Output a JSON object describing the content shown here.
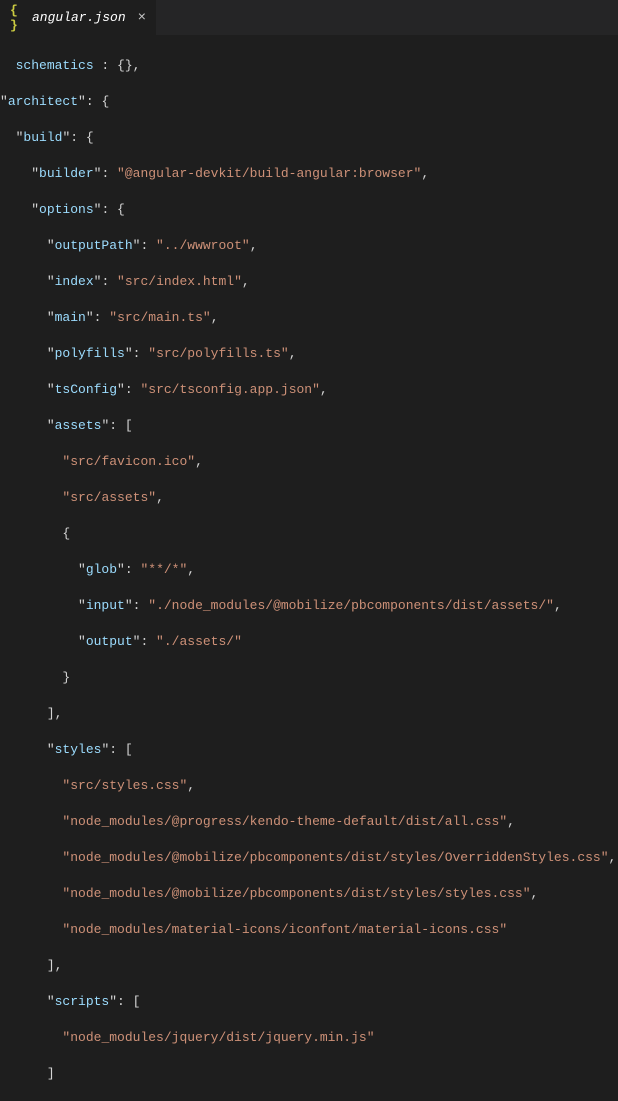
{
  "tab": {
    "filename": "angular.json",
    "icon_text": "{ }"
  },
  "code": {
    "l1_k": "schematics",
    "l1_tail": " : {},",
    "l2_k": "architect",
    "l2_tail": ": {",
    "l3_k": "build",
    "l3_tail": ": {",
    "l4_k": "builder",
    "l4_v": "@angular-devkit/build-angular:browser",
    "l5_k": "options",
    "l5_tail": ": {",
    "l6_k": "outputPath",
    "l6_v": "../wwwroot",
    "l7_k": "index",
    "l7_v": "src/index.html",
    "l8_k": "main",
    "l8_v": "src/main.ts",
    "l9_k": "polyfills",
    "l9_v": "src/polyfills.ts",
    "l10_k": "tsConfig",
    "l10_v": "src/tsconfig.app.json",
    "l11_k": "assets",
    "l11_tail": ": [",
    "l12_v": "src/favicon.ico",
    "l13_v": "src/assets",
    "l14": "{",
    "l15_k": "glob",
    "l15_v": "**/*",
    "l16_k": "input",
    "l16_v": "./node_modules/@mobilize/pbcomponents/dist/assets/",
    "l17_k": "output",
    "l17_v": "./assets/",
    "l18": "}",
    "l19": "],",
    "l20_k": "styles",
    "l20_tail": ": [",
    "l21_v": "src/styles.css",
    "l22_v": "node_modules/@progress/kendo-theme-default/dist/all.css",
    "l23_v": "node_modules/@mobilize/pbcomponents/dist/styles/OverriddenStyles.css",
    "l24_v": "node_modules/@mobilize/pbcomponents/dist/styles/styles.css",
    "l25_v": "node_modules/material-icons/iconfont/material-icons.css",
    "l26": "],",
    "l27_k": "scripts",
    "l27_tail": ": [",
    "l28_v": "node_modules/jquery/dist/jquery.min.js",
    "l29": "]"
  }
}
